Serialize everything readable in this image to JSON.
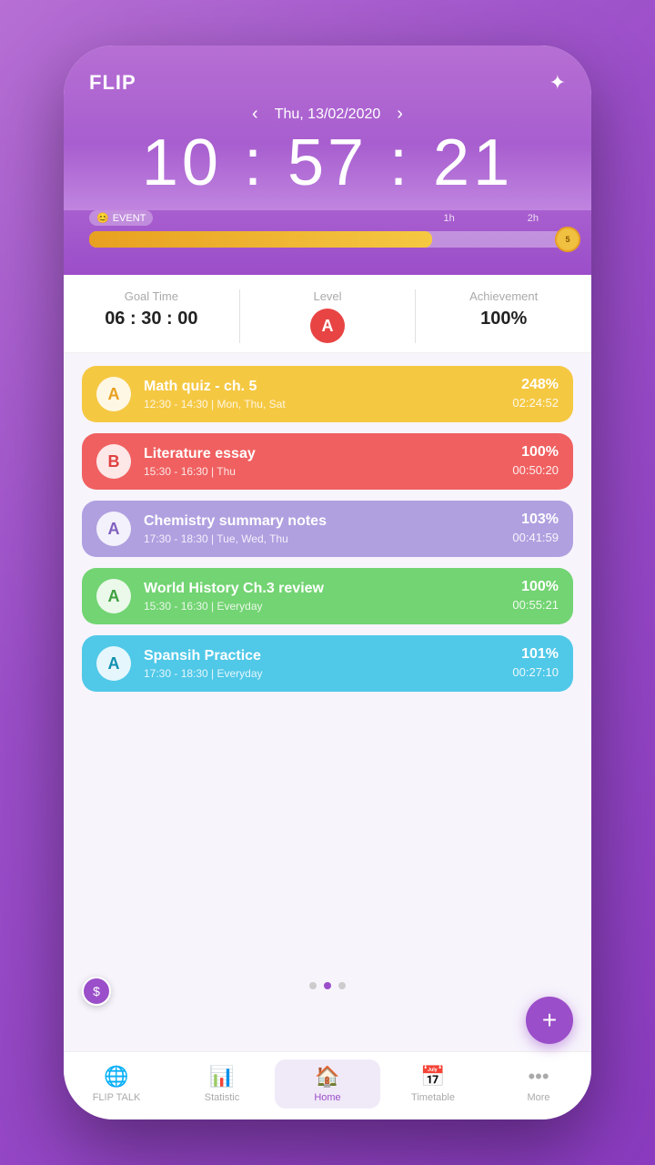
{
  "app": {
    "title": "FLIP"
  },
  "header": {
    "date": "Thu, 13/02/2020",
    "time": "10 : 57 : 21",
    "prev_arrow": "‹",
    "next_arrow": "›",
    "dots_icon": "✦"
  },
  "progress": {
    "event_label": "EVENT",
    "marker_1h": "1h",
    "marker_2h": "2h",
    "coin_count": "5",
    "fill_percent": 72
  },
  "stats": {
    "goal_label": "Goal Time",
    "goal_value": "06 : 30 : 00",
    "level_label": "Level",
    "level_value": "A",
    "achievement_label": "Achievement",
    "achievement_value": "100%"
  },
  "tasks": [
    {
      "id": 1,
      "color": "yellow",
      "badge": "A",
      "title": "Math quiz - ch. 5",
      "schedule": "12:30 - 14:30  |  Mon, Thu, Sat",
      "percent": "248%",
      "time": "02:24:52"
    },
    {
      "id": 2,
      "color": "red",
      "badge": "B",
      "title": "Literature essay",
      "schedule": "15:30 - 16:30  |  Thu",
      "percent": "100%",
      "time": "00:50:20"
    },
    {
      "id": 3,
      "color": "purple",
      "badge": "A",
      "title": "Chemistry summary notes",
      "schedule": "17:30 - 18:30  |  Tue, Wed, Thu",
      "percent": "103%",
      "time": "00:41:59"
    },
    {
      "id": 4,
      "color": "green",
      "badge": "A",
      "title": "World History Ch.3 review",
      "schedule": "15:30 - 16:30  |  Everyday",
      "percent": "100%",
      "time": "00:55:21"
    },
    {
      "id": 5,
      "color": "blue",
      "badge": "A",
      "title": "Spansih Practice",
      "schedule": "17:30 - 18:30  |  Everyday",
      "percent": "101%",
      "time": "00:27:10"
    }
  ],
  "pagination": {
    "dots": [
      false,
      true,
      false
    ]
  },
  "fab": {
    "icon": "+"
  },
  "nav": {
    "items": [
      {
        "id": "flip-talk",
        "label": "FLIP TALK",
        "active": false
      },
      {
        "id": "statistic",
        "label": "Statistic",
        "active": false
      },
      {
        "id": "home",
        "label": "Home",
        "active": true
      },
      {
        "id": "timetable",
        "label": "Timetable",
        "active": false
      },
      {
        "id": "more",
        "label": "More",
        "active": false
      }
    ]
  },
  "coin_circle": {
    "icon": "$"
  }
}
